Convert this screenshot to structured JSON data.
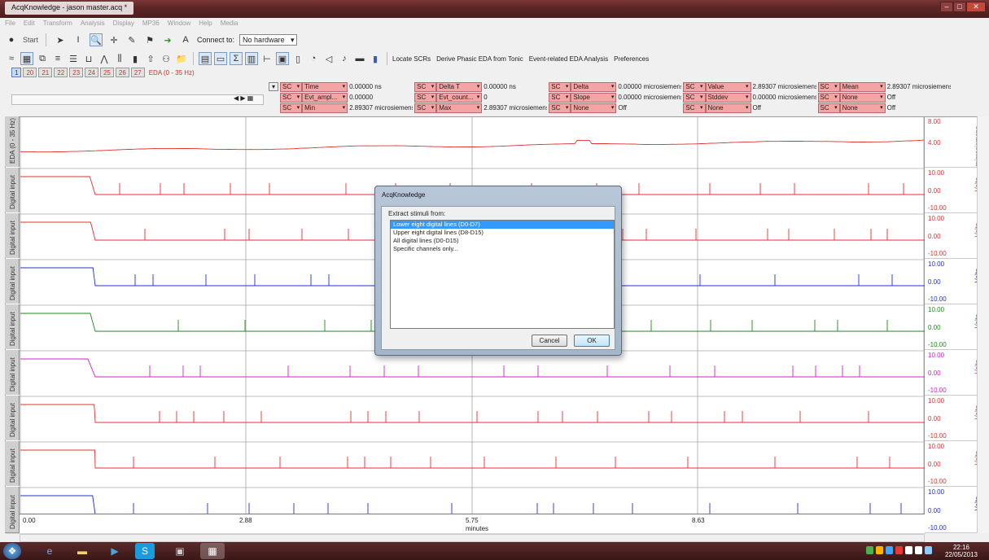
{
  "window": {
    "title": "AcqKnowledge - jason master.acq *"
  },
  "menu": [
    "File",
    "Edit",
    "Transform",
    "Analysis",
    "Display",
    "MP36",
    "Window",
    "Help",
    "Media"
  ],
  "toolbar1": {
    "start_label": "Start",
    "connect_label": "Connect to:",
    "connect_value": "No hardware"
  },
  "toolbar2": {
    "links": [
      "Locate SCRs",
      "Derive Phasic EDA from Tonic",
      "Event-related EDA Analysis",
      "Preferences"
    ]
  },
  "channel_tabs": [
    "1",
    "20",
    "21",
    "22",
    "23",
    "24",
    "25",
    "26",
    "27"
  ],
  "channel_caption": "EDA (0 - 35 Hz)",
  "measurements": [
    [
      {
        "sc": "SC",
        "fn": "Time",
        "val": "0.00000 ns"
      },
      {
        "sc": "SC",
        "fn": "Delta T",
        "val": "0.00000 ns"
      },
      {
        "sc": "SC",
        "fn": "Delta",
        "val": "0.00000 microsiemens"
      },
      {
        "sc": "SC",
        "fn": "Value",
        "val": "2.89307 microsiemens"
      },
      {
        "sc": "SC",
        "fn": "Mean",
        "val": "2.89307 microsiemens"
      }
    ],
    [
      {
        "sc": "SC",
        "fn": "Evt_ampl...",
        "val": "0.00000"
      },
      {
        "sc": "SC",
        "fn": "Evt_count...",
        "val": "0"
      },
      {
        "sc": "SC",
        "fn": "Slope",
        "val": "0.00000 microsiemens"
      },
      {
        "sc": "SC",
        "fn": "Stddev",
        "val": "0.00000 microsiemens"
      },
      {
        "sc": "SC",
        "fn": "None",
        "val": "Off"
      }
    ],
    [
      {
        "sc": "SC",
        "fn": "Min",
        "val": "2.89307 microsiemens"
      },
      {
        "sc": "SC",
        "fn": "Max",
        "val": "2.89307 microsiemens"
      },
      {
        "sc": "SC",
        "fn": "None",
        "val": "Off"
      },
      {
        "sc": "SC",
        "fn": "None",
        "val": "Off"
      },
      {
        "sc": "SC",
        "fn": "None",
        "val": "Off"
      }
    ]
  ],
  "lanes": [
    {
      "caption": "EDA (0 - 35 Hz)",
      "top": "8.00",
      "mid": "4.00",
      "bottom": "",
      "unit": "microsiemens",
      "color": "#e03030"
    },
    {
      "caption": "Digital input",
      "top": "10.00",
      "mid": "0.00",
      "bottom": "-10.00",
      "unit": "Volts",
      "color": "#e03030"
    },
    {
      "caption": "Digital input",
      "top": "10.00",
      "mid": "0.00",
      "bottom": "-10.00",
      "unit": "Volts",
      "color": "#e03030"
    },
    {
      "caption": "Digital input",
      "top": "10.00",
      "mid": "0.00",
      "bottom": "-10.00",
      "unit": "Volts",
      "color": "#2030d0"
    },
    {
      "caption": "Digital input",
      "top": "10.00",
      "mid": "0.00",
      "bottom": "-10.00",
      "unit": "Volts",
      "color": "#1a8a1a"
    },
    {
      "caption": "Digital input",
      "top": "10.00",
      "mid": "0.00",
      "bottom": "-10.00",
      "unit": "Volts",
      "color": "#d020c8"
    },
    {
      "caption": "Digital input",
      "top": "10.00",
      "mid": "0.00",
      "bottom": "-10.00",
      "unit": "Volts",
      "color": "#e03030"
    },
    {
      "caption": "Digital input",
      "top": "10.00",
      "mid": "0.00",
      "bottom": "-10.00",
      "unit": "Volts",
      "color": "#e03030"
    },
    {
      "caption": "Digital input",
      "top": "10.00",
      "mid": "0.00",
      "bottom": "-10.00",
      "unit": "Volts",
      "color": "#2030d0"
    }
  ],
  "time_axis": {
    "ticks": [
      "0.00",
      "2.88",
      "5.75",
      "8.63"
    ],
    "label": "minutes"
  },
  "dialog": {
    "title": "AcqKnowledge",
    "prompt": "Extract stimuli from:",
    "options": [
      "Lower eight digital lines (D0-D7)",
      "Upper eight digital lines (D8-D15)",
      "All digital lines (D0-D15)",
      "Specific channels only..."
    ],
    "selected_index": 0,
    "cancel_label": "Cancel",
    "ok_label": "OK"
  },
  "taskbar": {
    "clock_time": "22:16",
    "clock_date": "22/05/2013"
  }
}
